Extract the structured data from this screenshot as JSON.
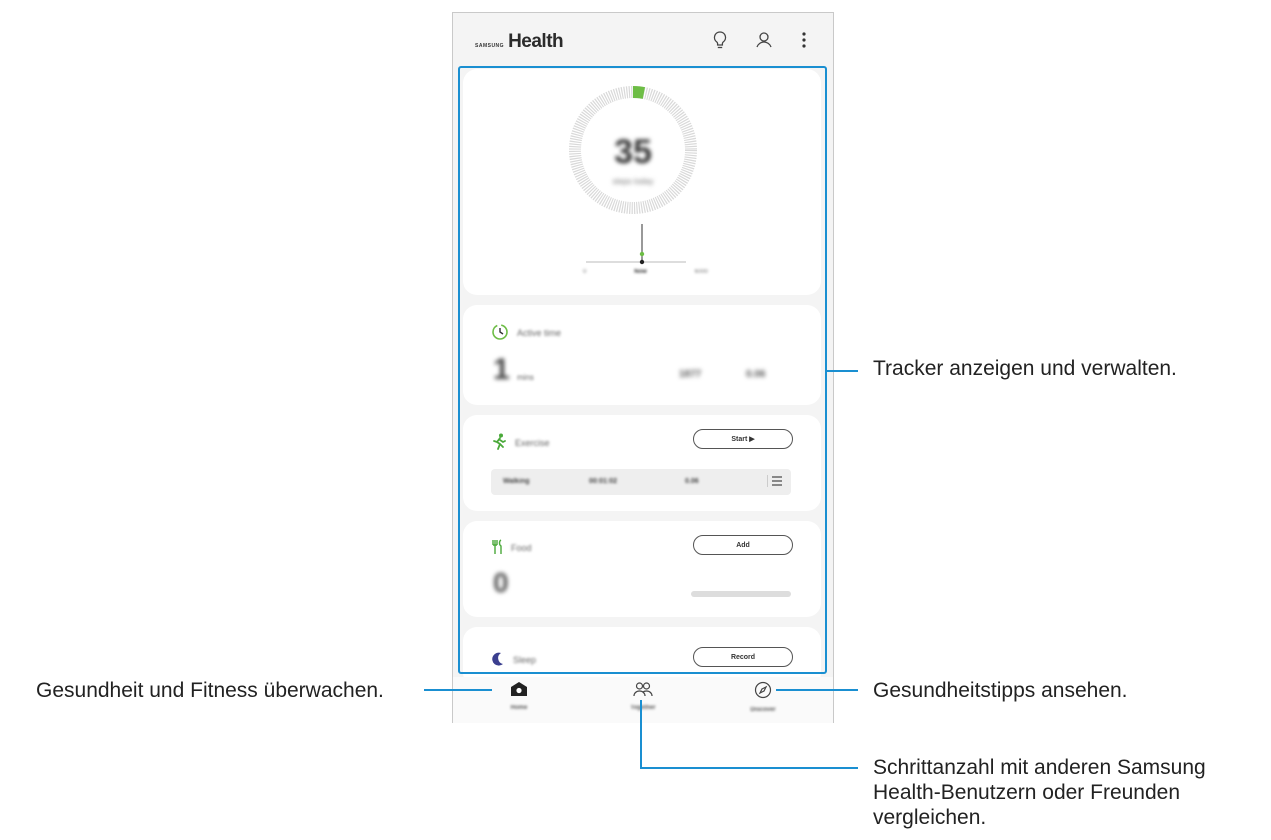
{
  "app": {
    "brand_small": "SAMSUNG",
    "brand_title": "Health"
  },
  "appbar": {
    "icons": [
      "lightbulb-icon",
      "person-icon",
      "more-options-icon"
    ]
  },
  "steps": {
    "value": "35",
    "label": "steps today",
    "goal_progress": 0.03,
    "timeline_labels": [
      "0",
      "Now",
      "6000"
    ]
  },
  "active_time": {
    "label": "Active time",
    "value": "1",
    "unit": "mins",
    "right_a": "1877",
    "right_b": "0.06"
  },
  "exercise": {
    "label": "Exercise",
    "start_button": "Start ▶",
    "row": {
      "type": "Walking",
      "duration": "00:01:02",
      "distance": "0.06"
    }
  },
  "food": {
    "label": "Food",
    "add_button": "Add",
    "value": "0"
  },
  "sleep": {
    "label": "Sleep",
    "record_button": "Record"
  },
  "bottom_nav": [
    {
      "label": "Home",
      "icon": "home-icon"
    },
    {
      "label": "Together",
      "icon": "people-icon"
    },
    {
      "label": "Discover",
      "icon": "compass-icon"
    }
  ],
  "annotations": {
    "tracker": "Tracker anzeigen und verwalten.",
    "home": "Gesundheit und Fitness überwachen.",
    "discover": "Gesundheitstipps ansehen.",
    "together_line1": "Schrittanzahl mit anderen Samsung",
    "together_line2": "Health-Benutzern oder Freunden",
    "together_line3": "vergleichen."
  },
  "colors": {
    "accent_green": "#6dbd45",
    "callout_blue": "#1a8fd1"
  }
}
